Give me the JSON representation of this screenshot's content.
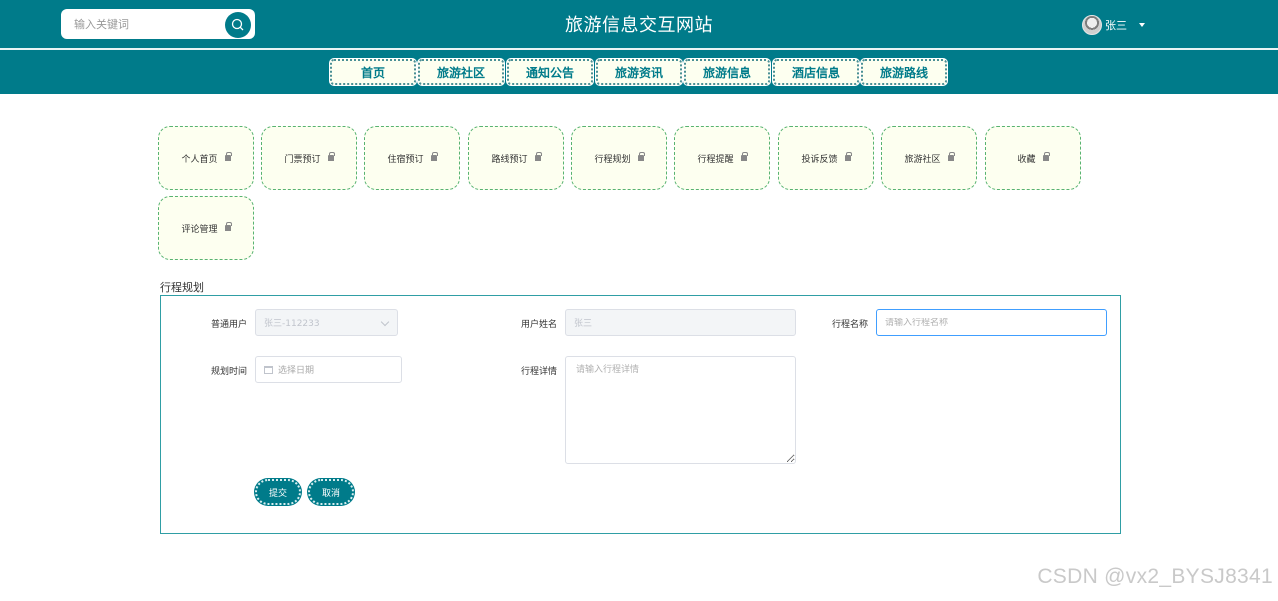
{
  "header": {
    "search_placeholder": "输入关键词",
    "site_title": "旅游信息交互网站",
    "user_name": "张三"
  },
  "nav": [
    {
      "label": "首页"
    },
    {
      "label": "旅游社区"
    },
    {
      "label": "通知公告"
    },
    {
      "label": "旅游资讯"
    },
    {
      "label": "旅游信息"
    },
    {
      "label": "酒店信息"
    },
    {
      "label": "旅游路线"
    }
  ],
  "menu_tiles": [
    {
      "label": "个人首页"
    },
    {
      "label": "门票预订"
    },
    {
      "label": "住宿预订"
    },
    {
      "label": "路线预订"
    },
    {
      "label": "行程规划"
    },
    {
      "label": "行程提醒"
    },
    {
      "label": "投诉反馈"
    },
    {
      "label": "旅游社区"
    },
    {
      "label": "收藏"
    },
    {
      "label": "评论管理"
    }
  ],
  "form": {
    "section_title": "行程规划",
    "user_type_label": "普通用户",
    "user_type_value": "张三-112233",
    "username_label": "用户姓名",
    "username_value": "张三",
    "trip_name_label": "行程名称",
    "trip_name_placeholder": "请输入行程名称",
    "plan_time_label": "规划时间",
    "plan_time_placeholder": "选择日期",
    "trip_detail_label": "行程详情",
    "trip_detail_placeholder": "请输入行程详情",
    "submit_label": "提交",
    "cancel_label": "取消"
  },
  "watermark": "CSDN @vx2_BYSJ8341",
  "colors": {
    "primary": "#007b8a",
    "tile_bg": "#fdfff0",
    "tile_border": "#58b371"
  }
}
